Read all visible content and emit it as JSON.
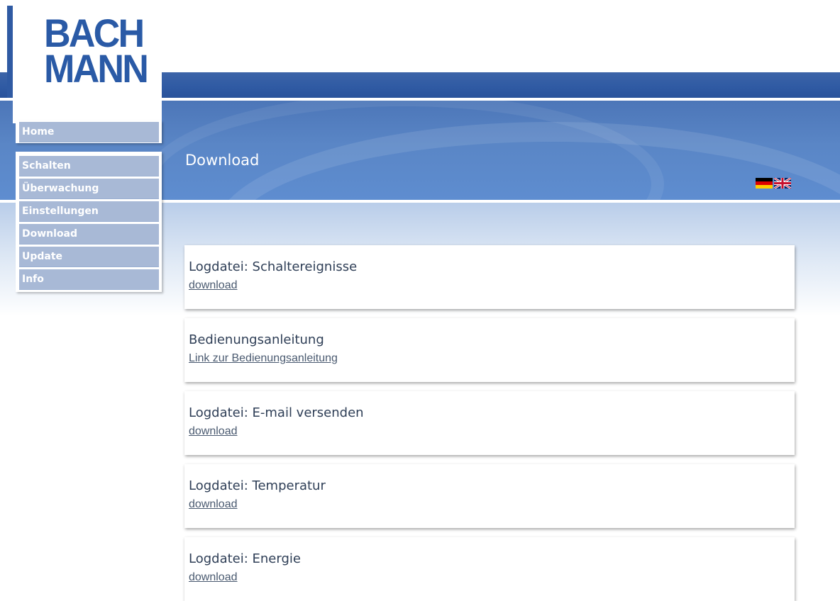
{
  "logo": {
    "line1": "BACH",
    "line2": "MANN"
  },
  "header": {
    "title": "Download"
  },
  "languages": [
    {
      "name": "Deutsch",
      "icon": "germany-flag-icon"
    },
    {
      "name": "English",
      "icon": "uk-flag-icon"
    }
  ],
  "nav": {
    "home": "Home",
    "items": [
      "Schalten",
      "Überwachung",
      "Einstellungen",
      "Download",
      "Update",
      "Info"
    ]
  },
  "cards": [
    {
      "title": "Logdatei: Schaltereignisse",
      "link": "download"
    },
    {
      "title": "Bedienungsanleitung",
      "link": "Link zur Bedienungsanleitung"
    },
    {
      "title": "Logdatei: E-mail versenden",
      "link": "download"
    },
    {
      "title": "Logdatei: Temperatur",
      "link": "download"
    },
    {
      "title": "Logdatei: Energie",
      "link": "download"
    }
  ],
  "colors": {
    "brand": "#2a5aa6",
    "nav_item": "#a8b9d6",
    "banner": "#5a86c6"
  }
}
